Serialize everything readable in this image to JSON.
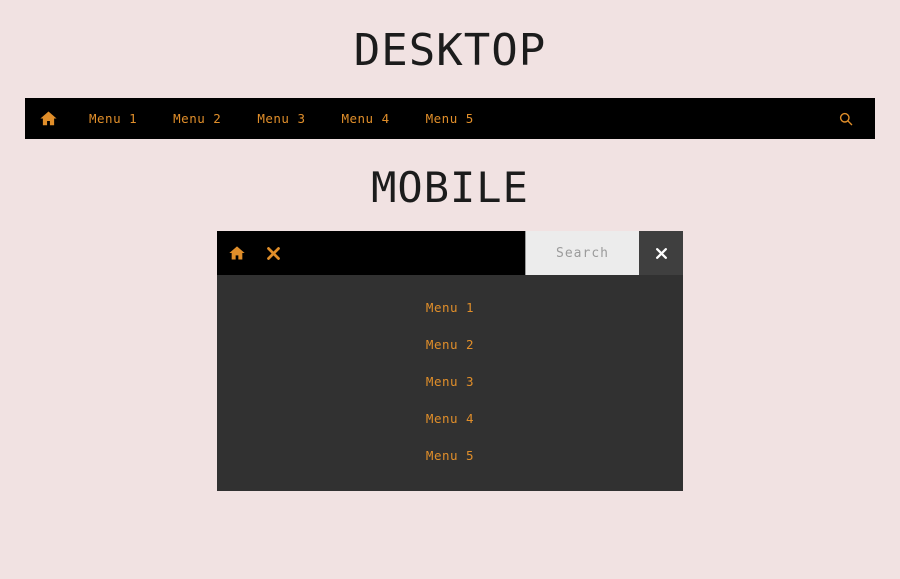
{
  "page": {
    "background_color": "#f1e2e2",
    "accent_color": "#e08e2a",
    "bar_color": "#000000",
    "dropdown_color": "#313131",
    "close_button_color": "#3f3f3f",
    "search_field_color": "#ececec"
  },
  "desktop": {
    "title": "DESKTOP",
    "home_icon": "home-icon",
    "search_icon": "search-icon",
    "menu": [
      {
        "label": "Menu 1"
      },
      {
        "label": "Menu 2"
      },
      {
        "label": "Menu 3"
      },
      {
        "label": "Menu 4"
      },
      {
        "label": "Menu 5"
      }
    ]
  },
  "mobile": {
    "title": "MOBILE",
    "home_icon": "home-icon",
    "close_icon": "close-icon",
    "toggle_icon": "close-icon",
    "search": {
      "placeholder": "Search",
      "value": ""
    },
    "menu": [
      {
        "label": "Menu 1"
      },
      {
        "label": "Menu 2"
      },
      {
        "label": "Menu 3"
      },
      {
        "label": "Menu 4"
      },
      {
        "label": "Menu 5"
      }
    ]
  }
}
